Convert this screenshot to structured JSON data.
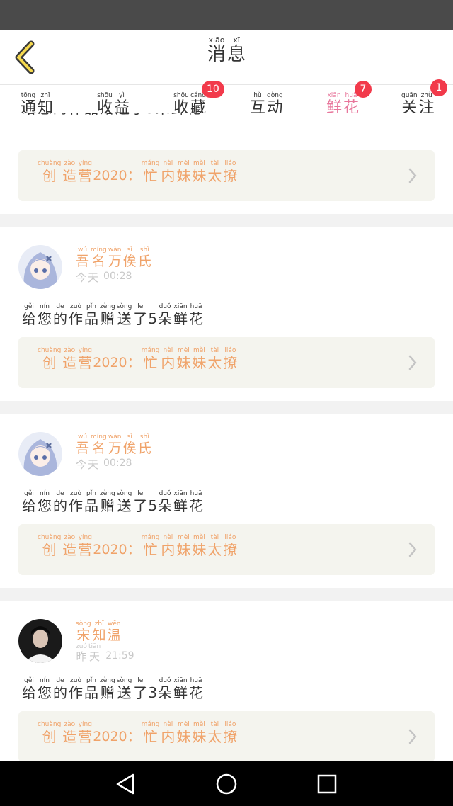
{
  "header": {
    "title": [
      {
        "py": "xiāo",
        "hz": "消"
      },
      {
        "py": "xī",
        "hz": "息"
      }
    ]
  },
  "tabs": [
    {
      "chars": [
        {
          "py": "tōng",
          "hz": "通"
        },
        {
          "py": "zhī",
          "hz": "知"
        }
      ],
      "badge": null,
      "active": false
    },
    {
      "chars": [
        {
          "py": "shōu",
          "hz": "收"
        },
        {
          "py": "yì",
          "hz": "益"
        }
      ],
      "badge": null,
      "active": false
    },
    {
      "chars": [
        {
          "py": "shōu",
          "hz": "收"
        },
        {
          "py": "cáng",
          "hz": "藏"
        }
      ],
      "badge": "10",
      "active": false
    },
    {
      "chars": [
        {
          "py": "hù",
          "hz": "互"
        },
        {
          "py": "dòng",
          "hz": "动"
        }
      ],
      "badge": null,
      "active": false
    },
    {
      "chars": [
        {
          "py": "xiān",
          "hz": "鲜"
        },
        {
          "py": "huā",
          "hz": "花"
        }
      ],
      "badge": "7",
      "active": true
    },
    {
      "chars": [
        {
          "py": "guān",
          "hz": "关"
        },
        {
          "py": "zhù",
          "hz": "注"
        }
      ],
      "badge": "1",
      "active": false
    }
  ],
  "work_title": {
    "prefix": [
      {
        "py": "chuàng",
        "hz": "创"
      },
      {
        "py": "zào",
        "hz": "造"
      },
      {
        "py": "yíng",
        "hz": "营"
      }
    ],
    "year": "2020",
    "colon": "：",
    "suffix": [
      {
        "py": "máng",
        "hz": "忙"
      },
      {
        "py": "nèi",
        "hz": "内"
      },
      {
        "py": "mèi",
        "hz": "妹"
      },
      {
        "py": "mèi",
        "hz": "妹"
      },
      {
        "py": "tài",
        "hz": "太"
      },
      {
        "py": "liáo",
        "hz": "撩"
      }
    ]
  },
  "notifications": [
    {
      "partial": true,
      "name": [],
      "day": [],
      "time": "",
      "avatar": "anime-girl",
      "msg_pre": [
        {
          "py": "",
          "hz": "给"
        },
        {
          "py": "",
          "hz": "您"
        },
        {
          "py": "",
          "hz": "的"
        },
        {
          "py": "",
          "hz": "作"
        },
        {
          "py": "",
          "hz": "品"
        },
        {
          "py": "",
          "hz": "赠"
        },
        {
          "py": "",
          "hz": "送"
        },
        {
          "py": "",
          "hz": "了"
        }
      ],
      "count": "5",
      "msg_post": [
        {
          "py": "",
          "hz": "朵"
        },
        {
          "py": "",
          "hz": "鲜"
        },
        {
          "py": "",
          "hz": "花"
        }
      ]
    },
    {
      "partial": false,
      "name": [
        {
          "py": "wú",
          "hz": "吾"
        },
        {
          "py": "míng",
          "hz": "名"
        },
        {
          "py": "wàn",
          "hz": "万"
        },
        {
          "py": "sì",
          "hz": "俟"
        },
        {
          "py": "shì",
          "hz": "氏"
        }
      ],
      "day": [
        {
          "py": "",
          "hz": "今"
        },
        {
          "py": "",
          "hz": "天"
        }
      ],
      "time": "00:28",
      "avatar": "anime-girl",
      "msg_pre": [
        {
          "py": "gěi",
          "hz": "给"
        },
        {
          "py": "nín",
          "hz": "您"
        },
        {
          "py": "de",
          "hz": "的"
        },
        {
          "py": "zuò",
          "hz": "作"
        },
        {
          "py": "pǐn",
          "hz": "品"
        },
        {
          "py": "zèng",
          "hz": "赠"
        },
        {
          "py": "sòng",
          "hz": "送"
        },
        {
          "py": "le",
          "hz": "了"
        }
      ],
      "count": "5",
      "msg_post": [
        {
          "py": "duǒ",
          "hz": "朵"
        },
        {
          "py": "xiān",
          "hz": "鲜"
        },
        {
          "py": "huā",
          "hz": "花"
        }
      ]
    },
    {
      "partial": false,
      "name": [
        {
          "py": "wú",
          "hz": "吾"
        },
        {
          "py": "míng",
          "hz": "名"
        },
        {
          "py": "wàn",
          "hz": "万"
        },
        {
          "py": "sì",
          "hz": "俟"
        },
        {
          "py": "shì",
          "hz": "氏"
        }
      ],
      "day": [
        {
          "py": "",
          "hz": "今"
        },
        {
          "py": "",
          "hz": "天"
        }
      ],
      "time": "00:28",
      "avatar": "anime-girl",
      "msg_pre": [
        {
          "py": "gěi",
          "hz": "给"
        },
        {
          "py": "nín",
          "hz": "您"
        },
        {
          "py": "de",
          "hz": "的"
        },
        {
          "py": "zuò",
          "hz": "作"
        },
        {
          "py": "pǐn",
          "hz": "品"
        },
        {
          "py": "zèng",
          "hz": "赠"
        },
        {
          "py": "sòng",
          "hz": "送"
        },
        {
          "py": "le",
          "hz": "了"
        }
      ],
      "count": "5",
      "msg_post": [
        {
          "py": "duǒ",
          "hz": "朵"
        },
        {
          "py": "xiān",
          "hz": "鲜"
        },
        {
          "py": "huā",
          "hz": "花"
        }
      ]
    },
    {
      "partial": false,
      "name": [
        {
          "py": "sòng",
          "hz": "宋"
        },
        {
          "py": "zhī",
          "hz": "知"
        },
        {
          "py": "wēn",
          "hz": "温"
        }
      ],
      "day": [
        {
          "py": "zuó",
          "hz": "昨"
        },
        {
          "py": "tiān",
          "hz": "天"
        }
      ],
      "time": "21:59",
      "avatar": "dark-portrait",
      "msg_pre": [
        {
          "py": "gěi",
          "hz": "给"
        },
        {
          "py": "nín",
          "hz": "您"
        },
        {
          "py": "de",
          "hz": "的"
        },
        {
          "py": "zuò",
          "hz": "作"
        },
        {
          "py": "pǐn",
          "hz": "品"
        },
        {
          "py": "zèng",
          "hz": "赠"
        },
        {
          "py": "sòng",
          "hz": "送"
        },
        {
          "py": "le",
          "hz": "了"
        }
      ],
      "count": "3",
      "msg_post": [
        {
          "py": "duǒ",
          "hz": "朵"
        },
        {
          "py": "xiān",
          "hz": "鲜"
        },
        {
          "py": "huā",
          "hz": "花"
        }
      ]
    }
  ],
  "nav": {
    "back": "triangle-back-icon",
    "home": "circle-home-icon",
    "recent": "square-recent-icon"
  },
  "colors": {
    "accent": "#e8779c",
    "orange": "#f0a36a",
    "badge": "#f23a4b"
  }
}
